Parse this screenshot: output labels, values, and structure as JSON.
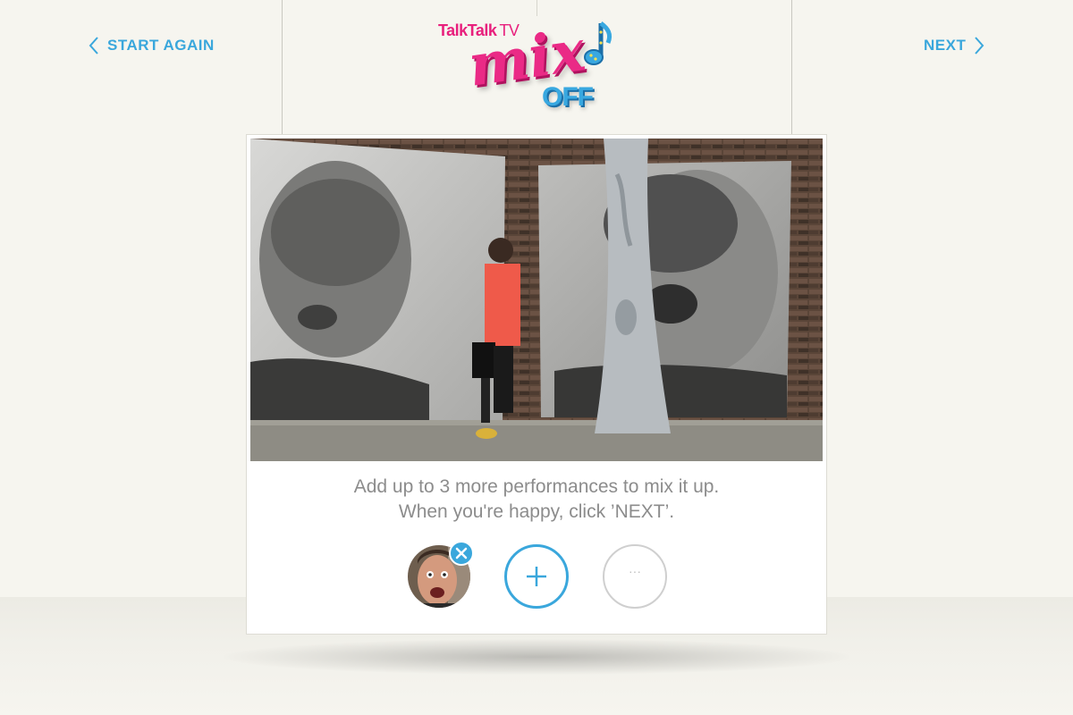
{
  "navigation": {
    "back_label": "START AGAIN",
    "next_label": "NEXT"
  },
  "logo": {
    "brand": "TalkTalk",
    "brand_suffix": "TV",
    "word_mix": "mix",
    "word_off": "OFF"
  },
  "instructions": {
    "line1": "Add up to 3 more performances to mix it up.",
    "line2": "When you're happy, click ’NEXT’."
  },
  "performances": {
    "empty_slot_text": "···"
  },
  "colors": {
    "accent": "#3aa7dc",
    "brand_pink": "#e8207d",
    "background": "#f6f5ef"
  },
  "icons": {
    "back": "chevron-left-icon",
    "next": "chevron-right-icon",
    "add": "plus-icon",
    "remove": "close-icon",
    "logo_note": "music-note-icon"
  }
}
